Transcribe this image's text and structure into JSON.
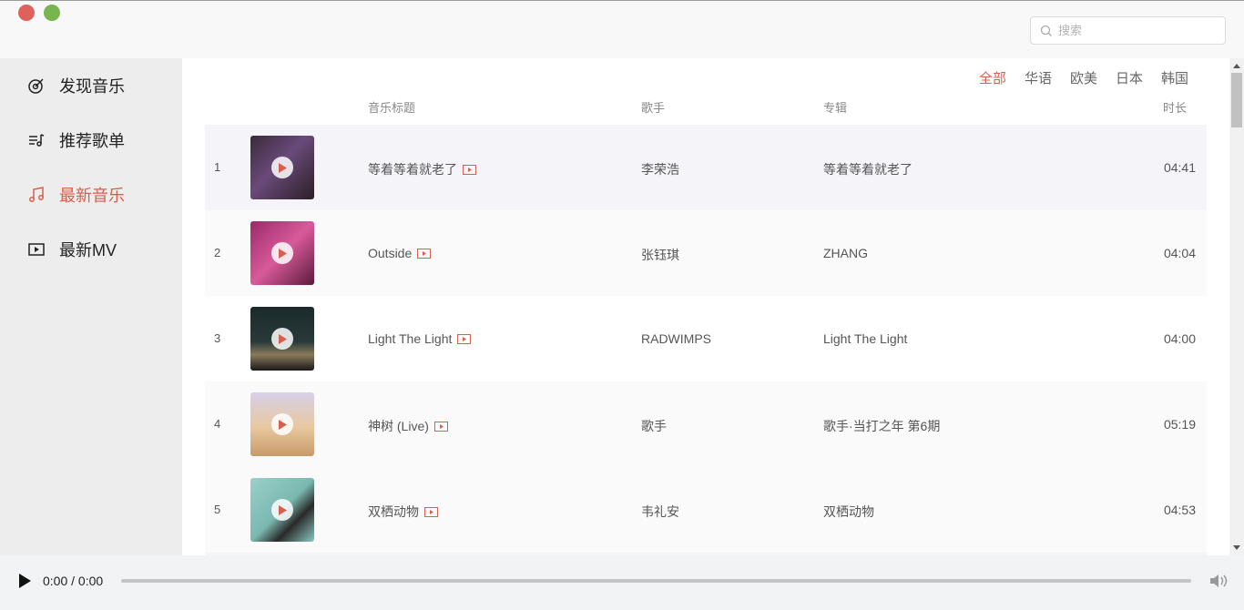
{
  "search": {
    "placeholder": "搜索"
  },
  "sidebar": {
    "items": [
      {
        "label": "发现音乐",
        "icon": "disc-icon",
        "active": false
      },
      {
        "label": "推荐歌单",
        "icon": "playlist-icon",
        "active": false
      },
      {
        "label": "最新音乐",
        "icon": "music-note-icon",
        "active": true
      },
      {
        "label": "最新MV",
        "icon": "video-icon",
        "active": false
      }
    ]
  },
  "tabs": [
    {
      "label": "全部",
      "active": true
    },
    {
      "label": "华语",
      "active": false
    },
    {
      "label": "欧美",
      "active": false
    },
    {
      "label": "日本",
      "active": false
    },
    {
      "label": "韩国",
      "active": false
    }
  ],
  "table": {
    "headers": {
      "title": "音乐标题",
      "singer": "歌手",
      "album": "专辑",
      "duration": "时长"
    },
    "rows": [
      {
        "index": "1",
        "title": "等着等着就老了",
        "singer": "李荣浩",
        "album": "等着等着就老了",
        "duration": "04:41"
      },
      {
        "index": "2",
        "title": "Outside",
        "singer": "张钰琪",
        "album": "ZHANG",
        "duration": "04:04"
      },
      {
        "index": "3",
        "title": "Light The Light",
        "singer": "RADWIMPS",
        "album": "Light The Light",
        "duration": "04:00"
      },
      {
        "index": "4",
        "title": "神树 (Live)",
        "singer": "歌手",
        "album": "歌手·当打之年 第6期",
        "duration": "05:19"
      },
      {
        "index": "5",
        "title": "双栖动物",
        "singer": "韦礼安",
        "album": "双栖动物",
        "duration": "04:53"
      }
    ]
  },
  "player": {
    "time": "0:00 / 0:00",
    "progress": 0
  },
  "colors": {
    "accent": "#d75f4d",
    "close_dot": "#e0605c",
    "max_dot": "#78b54e"
  }
}
